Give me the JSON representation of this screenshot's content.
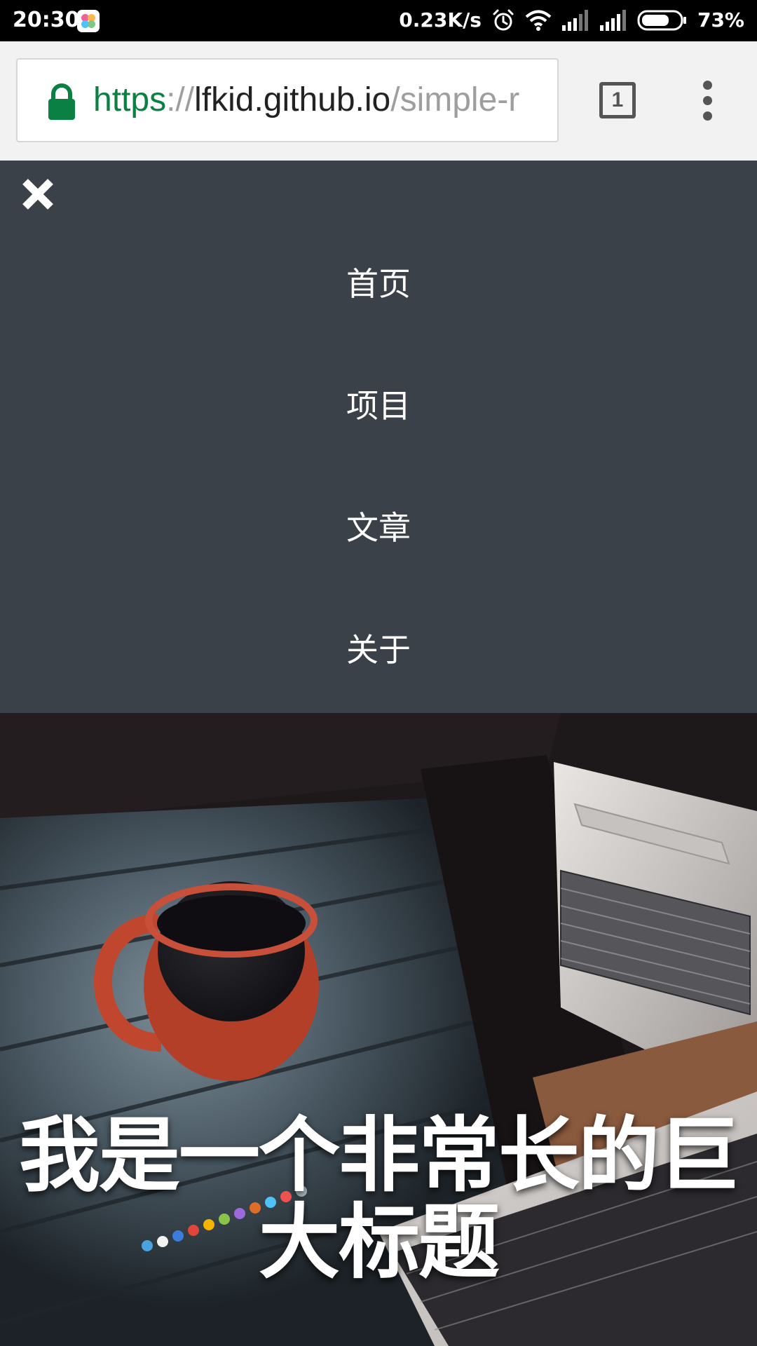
{
  "status_bar": {
    "time": "20:30",
    "net_speed": "0.23K/s",
    "battery_percent": "73%",
    "battery_level": 0.73,
    "icons": [
      "app-notification-icon",
      "alarm-icon",
      "wifi-icon",
      "signal-icon",
      "signal-icon",
      "battery-icon"
    ]
  },
  "browser": {
    "url_scheme": "https",
    "url_separator": "://",
    "url_host": "lfkid.github.io",
    "url_path": "/simple-r",
    "tab_count": "1",
    "colors": {
      "secure_green": "#0b8043",
      "toolbar_bg": "#f2f2f2"
    }
  },
  "nav": {
    "background": "#3b4148",
    "close_icon": "close-icon",
    "items": [
      {
        "label": "首页"
      },
      {
        "label": "项目"
      },
      {
        "label": "文章"
      },
      {
        "label": "关于"
      }
    ]
  },
  "hero": {
    "title": "我是一个非常长的巨大标题"
  }
}
